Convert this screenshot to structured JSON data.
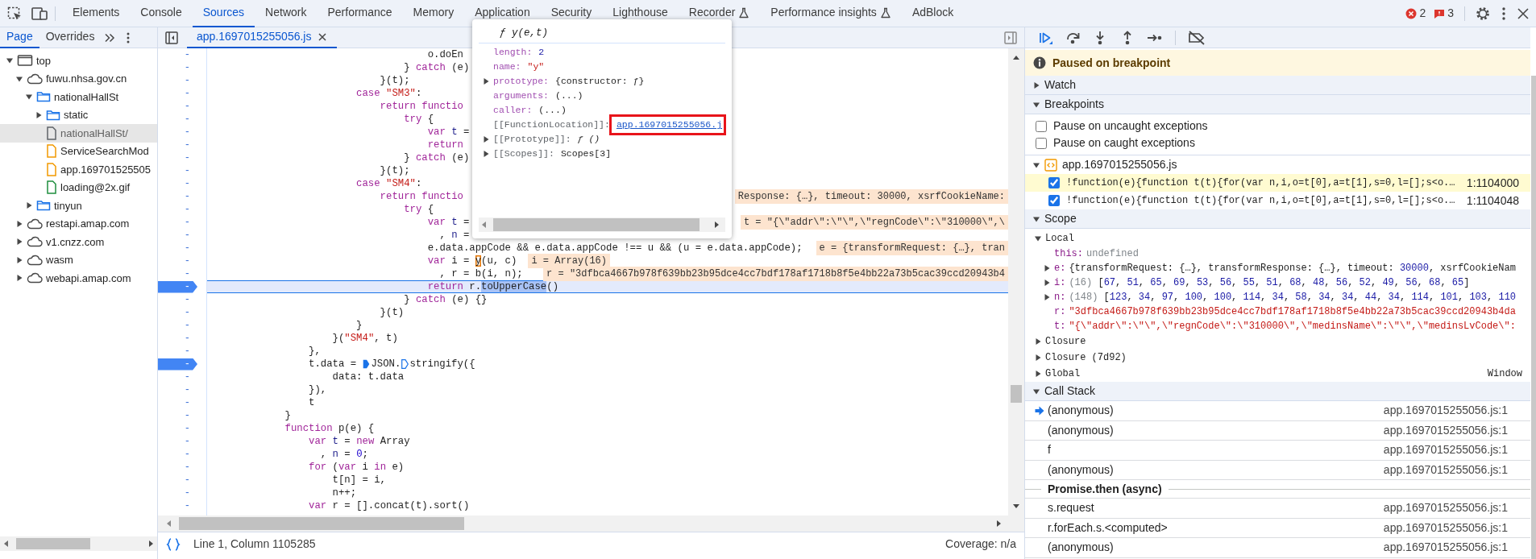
{
  "toolbar": {
    "tabs": [
      {
        "label": "Elements",
        "selected": false,
        "experimental": false
      },
      {
        "label": "Console",
        "selected": false,
        "experimental": false
      },
      {
        "label": "Sources",
        "selected": true,
        "experimental": false
      },
      {
        "label": "Network",
        "selected": false,
        "experimental": false
      },
      {
        "label": "Performance",
        "selected": false,
        "experimental": false
      },
      {
        "label": "Memory",
        "selected": false,
        "experimental": false
      },
      {
        "label": "Application",
        "selected": false,
        "experimental": false
      },
      {
        "label": "Security",
        "selected": false,
        "experimental": false
      },
      {
        "label": "Lighthouse",
        "selected": false,
        "experimental": false
      },
      {
        "label": "Recorder",
        "selected": false,
        "experimental": true
      },
      {
        "label": "Performance insights",
        "selected": false,
        "experimental": true
      },
      {
        "label": "AdBlock",
        "selected": false,
        "experimental": false
      }
    ],
    "errors": "2",
    "issues": "3"
  },
  "navigator": {
    "tabs": [
      {
        "label": "Page",
        "selected": true
      },
      {
        "label": "Overrides",
        "selected": false
      }
    ],
    "tree": [
      {
        "label": "top",
        "kind": "frame",
        "expanded": true,
        "selected": false,
        "children": [
          {
            "label": "fuwu.nhsa.gov.cn",
            "kind": "domain",
            "expanded": true,
            "selected": false,
            "children": [
              {
                "label": "nationalHallSt",
                "kind": "folder",
                "expanded": true,
                "selected": false,
                "children": [
                  {
                    "label": "static",
                    "kind": "folder",
                    "expanded": false,
                    "selected": false
                  },
                  {
                    "label": "nationalHallSt/",
                    "kind": "document",
                    "selected": true
                  },
                  {
                    "label": "ServiceSearchMod",
                    "kind": "script",
                    "selected": false
                  },
                  {
                    "label": "app.169701525505",
                    "kind": "script",
                    "selected": false
                  },
                  {
                    "label": "loading@2x.gif",
                    "kind": "image",
                    "selected": false
                  }
                ]
              },
              {
                "label": "tinyun",
                "kind": "folder",
                "expanded": false,
                "selected": false
              }
            ]
          },
          {
            "label": "restapi.amap.com",
            "kind": "domain",
            "expanded": false,
            "selected": false
          },
          {
            "label": "v1.cnzz.com",
            "kind": "domain",
            "expanded": false,
            "selected": false
          },
          {
            "label": "wasm",
            "kind": "domain",
            "expanded": false,
            "selected": false
          },
          {
            "label": "webapi.amap.com",
            "kind": "domain",
            "expanded": false,
            "selected": false
          }
        ]
      }
    ]
  },
  "editor": {
    "tab": {
      "label": "app.1697015255056.js",
      "selected": true
    },
    "lines": [
      {
        "gutter": "-",
        "breakpoint": false,
        "paused": false,
        "tokens": [
          {
            "kind": "plain",
            "text": "                                    o.doEn"
          }
        ]
      },
      {
        "gutter": "-",
        "breakpoint": false,
        "paused": false,
        "tokens": [
          {
            "kind": "plain",
            "text": "                                } "
          },
          {
            "kind": "keyword",
            "text": "catch"
          },
          {
            "kind": "plain",
            "text": " (e)"
          }
        ]
      },
      {
        "gutter": "-",
        "breakpoint": false,
        "paused": false,
        "tokens": [
          {
            "kind": "plain",
            "text": "                            }(t);"
          }
        ]
      },
      {
        "gutter": "-",
        "breakpoint": false,
        "paused": false,
        "tokens": [
          {
            "kind": "keyword",
            "text": "                        case "
          },
          {
            "kind": "string",
            "text": "\"SM3\""
          },
          {
            "kind": "plain",
            "text": ":"
          }
        ]
      },
      {
        "gutter": "-",
        "breakpoint": false,
        "paused": false,
        "tokens": [
          {
            "kind": "keyword",
            "text": "                            return functio"
          }
        ]
      },
      {
        "gutter": "-",
        "breakpoint": false,
        "paused": false,
        "tokens": [
          {
            "kind": "keyword",
            "text": "                                try"
          },
          {
            "kind": "plain",
            "text": " {"
          }
        ]
      },
      {
        "gutter": "-",
        "breakpoint": false,
        "paused": false,
        "tokens": [
          {
            "kind": "keyword",
            "text": "                                    var "
          },
          {
            "kind": "definition",
            "text": "t"
          },
          {
            "kind": "plain",
            "text": " ="
          }
        ]
      },
      {
        "gutter": "-",
        "breakpoint": false,
        "paused": false,
        "tokens": [
          {
            "kind": "keyword",
            "text": "                                    return"
          }
        ]
      },
      {
        "gutter": "-",
        "breakpoint": false,
        "paused": false,
        "tokens": [
          {
            "kind": "plain",
            "text": "                                } "
          },
          {
            "kind": "keyword",
            "text": "catch"
          },
          {
            "kind": "plain",
            "text": " (e)"
          }
        ]
      },
      {
        "gutter": "-",
        "breakpoint": false,
        "paused": false,
        "tokens": [
          {
            "kind": "plain",
            "text": "                            }(t);"
          }
        ]
      },
      {
        "gutter": "-",
        "breakpoint": false,
        "paused": false,
        "tokens": [
          {
            "kind": "keyword",
            "text": "                        case "
          },
          {
            "kind": "string",
            "text": "\"SM4\""
          },
          {
            "kind": "plain",
            "text": ":"
          }
        ]
      },
      {
        "gutter": "-",
        "breakpoint": false,
        "paused": false,
        "tokens": [
          {
            "kind": "keyword",
            "text": "                            return functio"
          }
        ],
        "value": "Response: {…}, timeout: 30000, xsrfCookieName:",
        "value_cut": true
      },
      {
        "gutter": "-",
        "breakpoint": false,
        "paused": false,
        "tokens": [
          {
            "kind": "keyword",
            "text": "                                try"
          },
          {
            "kind": "plain",
            "text": " {"
          }
        ]
      },
      {
        "gutter": "-",
        "breakpoint": false,
        "paused": false,
        "tokens": [
          {
            "kind": "keyword",
            "text": "                                    var "
          },
          {
            "kind": "definition",
            "text": "t"
          },
          {
            "kind": "plain",
            "text": " ="
          }
        ],
        "value": "t = \"{\\\"addr\\\":\\\"\\\",\\\"regnCode\\\":\\\"310000\\\",\\",
        "value_cut": true
      },
      {
        "gutter": "-",
        "breakpoint": false,
        "paused": false,
        "tokens": [
          {
            "kind": "plain",
            "text": "                                      , "
          },
          {
            "kind": "definition",
            "text": "n"
          },
          {
            "kind": "plain",
            "text": " ="
          }
        ]
      },
      {
        "gutter": "-",
        "breakpoint": false,
        "paused": false,
        "tokens": [
          {
            "kind": "plain",
            "text": "                                    e.data.appCode && e.data.appCode !== u && (u = e.data.appCode);"
          }
        ],
        "value": "e = {transformRequest: {…}, tran",
        "value_cut": true
      },
      {
        "gutter": "-",
        "breakpoint": false,
        "paused": false,
        "tokens": [
          {
            "kind": "keyword",
            "text": "                                    var"
          },
          {
            "kind": "plain",
            "text": " i = "
          },
          {
            "kind": "hovered",
            "text": "y"
          },
          {
            "kind": "plain",
            "text": "(u, c)"
          }
        ],
        "value": "i = Array(16)",
        "value_cut": false
      },
      {
        "gutter": "-",
        "breakpoint": false,
        "paused": false,
        "tokens": [
          {
            "kind": "plain",
            "text": "                                      , r = b(i, n);"
          }
        ],
        "value": "r = \"3dfbca4667b978f639bb23b95dce4cc7bdf178af1718b8f5e4bb22a73b5cac39ccd20943b4",
        "value_cut": true
      },
      {
        "gutter": "-",
        "breakpoint": true,
        "paused": true,
        "tokens": [
          {
            "kind": "keyword",
            "text": "                                    return"
          },
          {
            "kind": "plain",
            "text": " r."
          },
          {
            "kind": "selected",
            "text": "toUpperCase"
          },
          {
            "kind": "plain",
            "text": "()"
          }
        ]
      },
      {
        "gutter": "-",
        "breakpoint": false,
        "paused": false,
        "tokens": [
          {
            "kind": "plain",
            "text": "                                } "
          },
          {
            "kind": "keyword",
            "text": "catch"
          },
          {
            "kind": "plain",
            "text": " (e) {}"
          }
        ]
      },
      {
        "gutter": "-",
        "breakpoint": false,
        "paused": false,
        "tokens": [
          {
            "kind": "plain",
            "text": "                            }(t)"
          }
        ]
      },
      {
        "gutter": "-",
        "breakpoint": false,
        "paused": false,
        "tokens": [
          {
            "kind": "plain",
            "text": "                        }"
          }
        ]
      },
      {
        "gutter": "-",
        "breakpoint": false,
        "paused": false,
        "tokens": [
          {
            "kind": "plain",
            "text": "                    }("
          },
          {
            "kind": "string",
            "text": "\"SM4\""
          },
          {
            "kind": "plain",
            "text": ", t)"
          }
        ]
      },
      {
        "gutter": "-",
        "breakpoint": false,
        "paused": false,
        "tokens": [
          {
            "kind": "plain",
            "text": "                },"
          }
        ]
      },
      {
        "gutter": "-",
        "breakpoint": true,
        "paused": false,
        "tokens": [
          {
            "kind": "plain",
            "text": "                t.data = "
          },
          {
            "kind": "marker",
            "active": true
          },
          {
            "kind": "plain",
            "text": "JSON."
          },
          {
            "kind": "marker",
            "active": false
          },
          {
            "kind": "plain",
            "text": "stringify({"
          }
        ]
      },
      {
        "gutter": "-",
        "breakpoint": false,
        "paused": false,
        "tokens": [
          {
            "kind": "plain",
            "text": "                    data: t.data"
          }
        ]
      },
      {
        "gutter": "-",
        "breakpoint": false,
        "paused": false,
        "tokens": [
          {
            "kind": "plain",
            "text": "                }),"
          }
        ]
      },
      {
        "gutter": "-",
        "breakpoint": false,
        "paused": false,
        "tokens": [
          {
            "kind": "plain",
            "text": "                t"
          }
        ]
      },
      {
        "gutter": "-",
        "breakpoint": false,
        "paused": false,
        "tokens": [
          {
            "kind": "plain",
            "text": "            }"
          }
        ]
      },
      {
        "gutter": "-",
        "breakpoint": false,
        "paused": false,
        "tokens": [
          {
            "kind": "keyword",
            "text": "            function"
          },
          {
            "kind": "plain",
            "text": " p(e) {"
          }
        ]
      },
      {
        "gutter": "-",
        "breakpoint": false,
        "paused": false,
        "tokens": [
          {
            "kind": "keyword",
            "text": "                var "
          },
          {
            "kind": "definition",
            "text": "t"
          },
          {
            "kind": "plain",
            "text": " = "
          },
          {
            "kind": "keyword",
            "text": "new"
          },
          {
            "kind": "plain",
            "text": " Array"
          }
        ]
      },
      {
        "gutter": "-",
        "breakpoint": false,
        "paused": false,
        "tokens": [
          {
            "kind": "plain",
            "text": "                  , "
          },
          {
            "kind": "definition",
            "text": "n"
          },
          {
            "kind": "plain",
            "text": " = "
          },
          {
            "kind": "number",
            "text": "0"
          },
          {
            "kind": "plain",
            "text": ";"
          }
        ]
      },
      {
        "gutter": "-",
        "breakpoint": false,
        "paused": false,
        "tokens": [
          {
            "kind": "keyword",
            "text": "                for"
          },
          {
            "kind": "plain",
            "text": " ("
          },
          {
            "kind": "keyword",
            "text": "var"
          },
          {
            "kind": "plain",
            "text": " i "
          },
          {
            "kind": "keyword",
            "text": "in"
          },
          {
            "kind": "plain",
            "text": " e)"
          }
        ]
      },
      {
        "gutter": "-",
        "breakpoint": false,
        "paused": false,
        "tokens": [
          {
            "kind": "plain",
            "text": "                    t[n] = i,"
          }
        ]
      },
      {
        "gutter": "-",
        "breakpoint": false,
        "paused": false,
        "tokens": [
          {
            "kind": "plain",
            "text": "                    n++;"
          }
        ]
      },
      {
        "gutter": "-",
        "breakpoint": false,
        "paused": false,
        "tokens": [
          {
            "kind": "keyword",
            "text": "                var"
          },
          {
            "kind": "plain",
            "text": " r = [].concat(t).sort()"
          }
        ]
      }
    ],
    "status": {
      "position": "Line 1, Column 1105285",
      "coverage": "Coverage: n/a"
    }
  },
  "popup": {
    "title": "ƒ y(e,t)",
    "entries": [
      {
        "key": {
          "text": "length:",
          "kind": "own"
        },
        "value": {
          "text": "2",
          "kind": "number"
        },
        "expandable": false,
        "annotated": false
      },
      {
        "key": {
          "text": "name:",
          "kind": "own"
        },
        "value": {
          "text": "\"y\"",
          "kind": "string"
        },
        "expandable": false,
        "annotated": false
      },
      {
        "key": {
          "text": "prototype:",
          "kind": "own"
        },
        "value": {
          "text": "{constructor: ƒ}",
          "kind": "plain"
        },
        "expandable": true,
        "annotated": false
      },
      {
        "key": {
          "text": "arguments:",
          "kind": "own"
        },
        "value": {
          "text": "(...)",
          "kind": "plain"
        },
        "expandable": false,
        "annotated": false
      },
      {
        "key": {
          "text": "caller:",
          "kind": "own"
        },
        "value": {
          "text": "(...)",
          "kind": "plain"
        },
        "expandable": false,
        "annotated": false
      },
      {
        "key": {
          "text": "[[FunctionLocation]]:",
          "kind": "internal"
        },
        "value": {
          "text": "app.1697015255056.j",
          "kind": "link"
        },
        "expandable": false,
        "annotated": true
      },
      {
        "key": {
          "text": "[[Prototype]]:",
          "kind": "internal"
        },
        "value": {
          "text": "ƒ ()",
          "kind": "function"
        },
        "expandable": true,
        "annotated": false
      },
      {
        "key": {
          "text": "[[Scopes]]:",
          "kind": "internal"
        },
        "value": {
          "text": "Scopes[3]",
          "kind": "plain"
        },
        "expandable": true,
        "annotated": false
      }
    ]
  },
  "debugger": {
    "paused_message": "Paused on breakpoint",
    "watch": {
      "title": "Watch",
      "expanded": false
    },
    "breakpoints": {
      "title": "Breakpoints",
      "expanded": true,
      "options": [
        {
          "label": "Pause on uncaught exceptions",
          "checked": false
        },
        {
          "label": "Pause on caught exceptions",
          "checked": false
        }
      ],
      "files": [
        {
          "name": "app.1697015255056.js",
          "expanded": true,
          "items": [
            {
              "code": "!function(e){function t(t){for(var n,i,o=t[0],a=t[1],s=0,l=[];s<o.…",
              "location": "1:1104000",
              "checked": true,
              "current": true
            },
            {
              "code": "!function(e){function t(t){for(var n,i,o=t[0],a=t[1],s=0,l=[];s<o.…",
              "location": "1:1104048",
              "checked": true,
              "current": false
            }
          ]
        }
      ]
    },
    "scope": {
      "title": "Scope",
      "expanded": true,
      "groups": [
        {
          "title": "Local",
          "expanded": true,
          "children": [
            {
              "name": "this:",
              "value": "undefined",
              "kind": "undefined",
              "expandable": false
            },
            {
              "name": "e:",
              "value": "{transformRequest: {…}, transformResponse: {…}, timeout: 30000, xsrfCookieNam",
              "kind": "object",
              "expandable": true
            },
            {
              "name": "i:",
              "value": "(16) [67, 51, 65, 69, 53, 56, 55, 51, 68, 48, 56, 52, 49, 56, 68, 65]",
              "kind": "array",
              "expandable": true
            },
            {
              "name": "n:",
              "value": "(148) [123, 34, 97, 100, 100, 114, 34, 58, 34, 34, 44, 34, 114, 101, 103, 110",
              "kind": "array",
              "expandable": true
            },
            {
              "name": "r:",
              "value": "\"3dfbca4667b978f639bb23b95dce4cc7bdf178af1718b8f5e4bb22a73b5cac39ccd20943b4da",
              "kind": "string",
              "expandable": false
            },
            {
              "name": "t:",
              "value": "\"{\\\"addr\\\":\\\"\\\",\\\"regnCode\\\":\\\"310000\\\",\\\"medinsName\\\":\\\"\\\",\\\"medinsLvCode\\\":",
              "kind": "string",
              "expandable": false
            }
          ]
        },
        {
          "title": "Closure",
          "expanded": false
        },
        {
          "title": "Closure (7d92)",
          "expanded": false
        },
        {
          "title": "Global",
          "expanded": false,
          "value": "Window"
        }
      ]
    },
    "call_stack": {
      "title": "Call Stack",
      "expanded": true,
      "frames": [
        {
          "kind": "frame",
          "name": "(anonymous)",
          "location": "app.1697015255056.js:1",
          "selected": true
        },
        {
          "kind": "frame",
          "name": "(anonymous)",
          "location": "app.1697015255056.js:1",
          "selected": false
        },
        {
          "kind": "frame",
          "name": "f",
          "location": "app.1697015255056.js:1",
          "selected": false
        },
        {
          "kind": "frame",
          "name": "(anonymous)",
          "location": "app.1697015255056.js:1",
          "selected": false
        },
        {
          "kind": "async",
          "name": "Promise.then (async)"
        },
        {
          "kind": "frame",
          "name": "s.request",
          "location": "app.1697015255056.js:1",
          "selected": false
        },
        {
          "kind": "frame",
          "name": "r.forEach.s.<computed>",
          "location": "app.1697015255056.js:1",
          "selected": false
        },
        {
          "kind": "frame",
          "name": "(anonymous)",
          "location": "app.1697015255056.js:1",
          "selected": false
        }
      ]
    }
  }
}
